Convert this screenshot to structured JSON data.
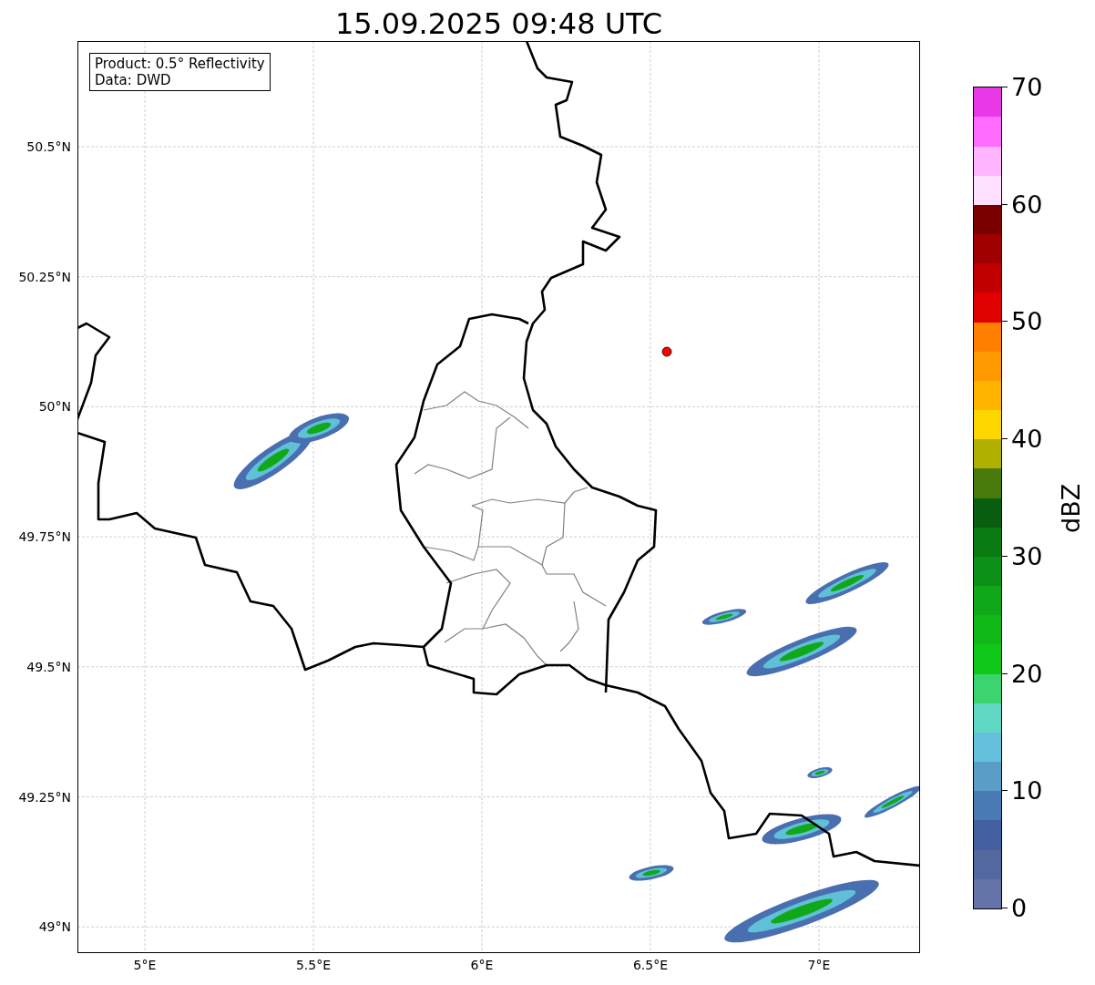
{
  "title": "15.09.2025 09:48 UTC",
  "map": {
    "info_box": [
      "Product: 0.5° Reflectivity",
      "Data: DWD"
    ],
    "x_axis": [
      "5°E",
      "5.5°E",
      "6°E",
      "6.5°E",
      "7°E"
    ],
    "y_axis": [
      "50.5°N",
      "50.25°N",
      "50°N",
      "49.75°N",
      "49.5°N",
      "49.25°N",
      "49°N"
    ]
  },
  "colorbar": {
    "label": "dBZ",
    "ticks": [
      "70",
      "60",
      "50",
      "40",
      "30",
      "20",
      "10",
      "0"
    ],
    "bins": [
      {
        "color": "#6474a8"
      },
      {
        "color": "#5468a0"
      },
      {
        "color": "#4460a0"
      },
      {
        "color": "#4a7ab4"
      },
      {
        "color": "#5a9ec8"
      },
      {
        "color": "#64c0dc"
      },
      {
        "color": "#60d8c4"
      },
      {
        "color": "#3cd46e"
      },
      {
        "color": "#10c818"
      },
      {
        "color": "#10b818"
      },
      {
        "color": "#10a818"
      },
      {
        "color": "#0c9018"
      },
      {
        "color": "#0a7a12"
      },
      {
        "color": "#085e0e"
      },
      {
        "color": "#487a0c"
      },
      {
        "color": "#b0b000"
      },
      {
        "color": "#ffd700"
      },
      {
        "color": "#ffb400"
      },
      {
        "color": "#ff9900"
      },
      {
        "color": "#ff7f00"
      },
      {
        "color": "#e00000"
      },
      {
        "color": "#c00000"
      },
      {
        "color": "#a00000"
      },
      {
        "color": "#7a0000"
      },
      {
        "color": "#ffe0ff"
      },
      {
        "color": "#ffb4ff"
      },
      {
        "color": "#ff6cff"
      },
      {
        "color": "#e838e8"
      }
    ]
  }
}
